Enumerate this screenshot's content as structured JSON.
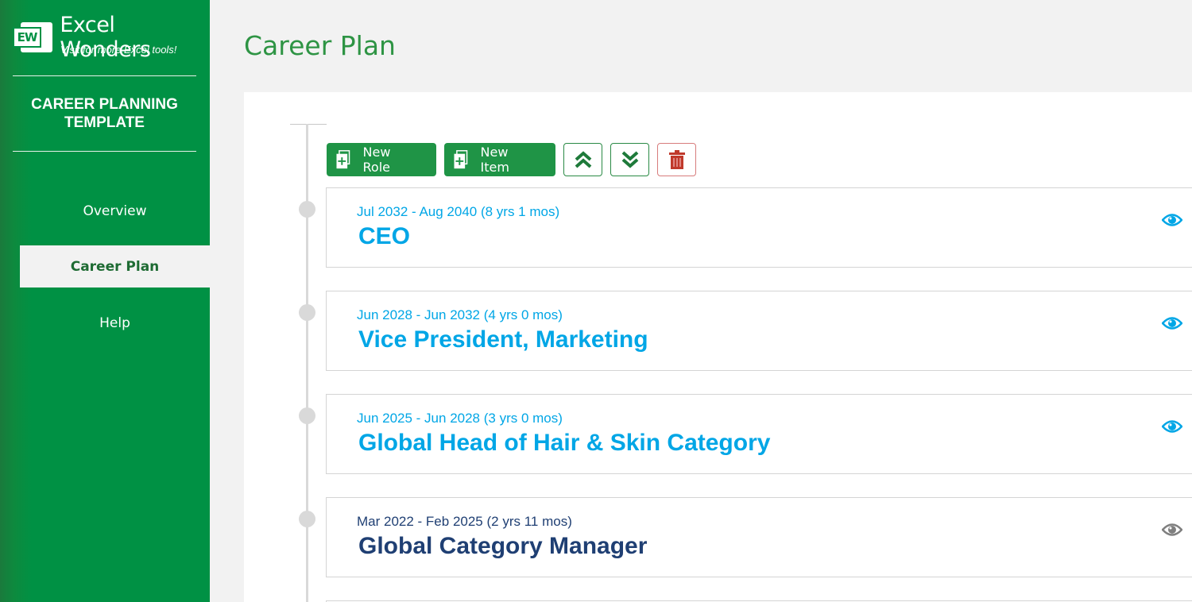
{
  "brand": {
    "name": "Excel Wonders",
    "logo_text": "EW",
    "tagline": "Visit for more Excel tools!"
  },
  "app_title": "CAREER PLANNING TEMPLATE",
  "nav": {
    "items": [
      {
        "label": "Overview",
        "active": false
      },
      {
        "label": "Career Plan",
        "active": true
      },
      {
        "label": "Help",
        "active": false
      }
    ]
  },
  "page": {
    "title": "Career Plan"
  },
  "toolbar": {
    "new_role_label": "New Role",
    "new_item_label": "New Item",
    "move_up_icon": "double-chevron-up-icon",
    "move_down_icon": "double-chevron-down-icon",
    "delete_icon": "trash-icon"
  },
  "roles": [
    {
      "dates": "Jul 2032 - Aug 2040 (8 yrs 1 mos)",
      "title": "CEO",
      "color": "#00a6e6",
      "visible": true
    },
    {
      "dates": "Jun 2028 - Jun 2032 (4 yrs 0 mos)",
      "title": "Vice President, Marketing",
      "color": "#00a6e6",
      "visible": true
    },
    {
      "dates": "Jun 2025 - Jun 2028 (3 yrs 0 mos)",
      "title": "Global Head of Hair & Skin Category",
      "color": "#00a6e6",
      "visible": true
    },
    {
      "dates": "Mar 2022 - Feb 2025 (2 yrs 11 mos)",
      "title": "Global Category Manager",
      "color": "#1f3f73",
      "visible": false
    }
  ],
  "colors": {
    "sidebar": "#009144",
    "accent": "#1f9446",
    "future_role": "#00a6e6",
    "current_role": "#1f3f73",
    "delete": "#c0392b"
  }
}
